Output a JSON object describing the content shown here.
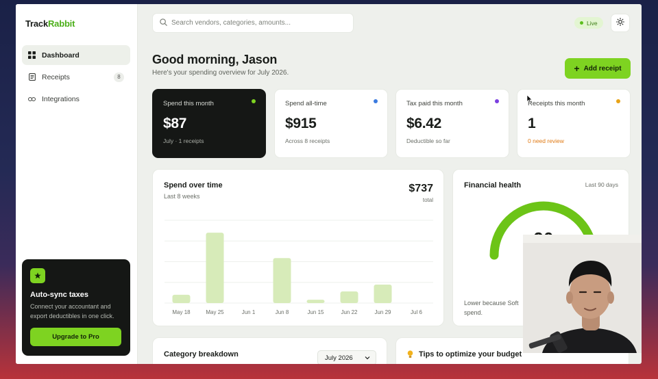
{
  "brand": {
    "name_part1": "Track",
    "name_part2": "Rabbit",
    "accent": "#4caf1a"
  },
  "sidebar": {
    "items": [
      {
        "label": "Dashboard",
        "icon": "grid-icon",
        "active": true
      },
      {
        "label": "Receipts",
        "icon": "receipt-icon",
        "badge": "8"
      },
      {
        "label": "Integrations",
        "icon": "link-icon"
      }
    ],
    "promo": {
      "icon": "star-icon",
      "title": "Auto-sync taxes",
      "text": "Connect your accountant and export deductibles in one click.",
      "button": "Upgrade to Pro"
    }
  },
  "header": {
    "search_placeholder": "Search vendors, categories, amounts...",
    "live_label": "Live",
    "theme_icon": "sun-icon"
  },
  "greeting": {
    "title": "Good morning, Jason",
    "subtitle": "Here's your spending overview for July 2026.",
    "add_button": "Add receipt"
  },
  "kpis": [
    {
      "label": "Spend this month",
      "value": "$87",
      "sub": "July · 1 receipts",
      "dot": "#7ed321"
    },
    {
      "label": "Spend all-time",
      "value": "$915",
      "sub": "Across 8 receipts",
      "dot": "#3b7be0"
    },
    {
      "label": "Tax paid this month",
      "value": "$6.42",
      "sub": "Deductible so far",
      "dot": "#7b3fe0"
    },
    {
      "label": "Receipts this month",
      "value": "1",
      "sub": "0 need review",
      "dot": "#e8a317"
    }
  ],
  "spend_chart": {
    "title": "Spend over time",
    "subtitle": "Last 8 weeks",
    "total": "$737",
    "total_label": "total"
  },
  "chart_data": {
    "type": "bar",
    "categories": [
      "May 18",
      "May 25",
      "Jun 1",
      "Jun 8",
      "Jun 15",
      "Jun 22",
      "Jun 29",
      "Jul 6"
    ],
    "values": [
      30,
      255,
      0,
      163,
      12,
      42,
      67,
      0
    ],
    "ylim": [
      0,
      300
    ],
    "grid": true,
    "bar_color": "#d7ebb9"
  },
  "health": {
    "title": "Financial health",
    "range": "Last 90 days",
    "score": "90",
    "score_fraction": 0.9,
    "note_line1": "Lower because Soft",
    "note_line2": "spend.",
    "gauge_color": "#6cc417"
  },
  "category": {
    "title": "Category breakdown",
    "select_value": "July 2026"
  },
  "tips": {
    "title": "Tips to optimize your budget",
    "icon": "lightbulb-icon"
  }
}
